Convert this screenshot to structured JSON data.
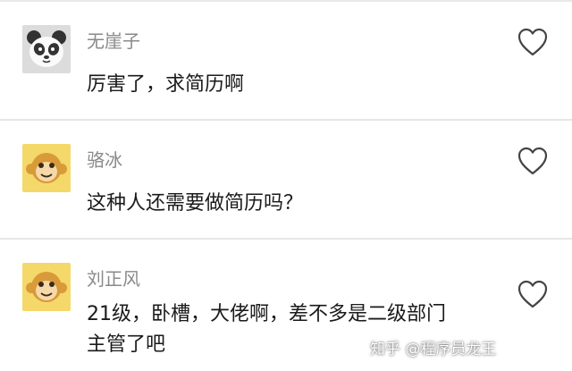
{
  "comments": [
    {
      "author": "无崖子",
      "text_lines": [
        "厉害了，求简历啊"
      ],
      "avatar": "panda-avatar-icon"
    },
    {
      "author": "骆冰",
      "text_lines": [
        "这种人还需要做简历吗？"
      ],
      "avatar": "monkey-avatar-icon"
    },
    {
      "author": "刘正风",
      "text_lines": [
        "21级，卧槽，大佬啊，差不多是二级部门",
        "主管了吧"
      ],
      "avatar": "monkey-avatar-icon"
    }
  ],
  "watermark": "知乎 @程序员龙王",
  "colors": {
    "author": "#8a8a8a",
    "text": "#1a1a1a",
    "divider": "#e6e6e6",
    "monkey_bg": "#f5d86a",
    "panda_bg": "#dcdcdc"
  }
}
